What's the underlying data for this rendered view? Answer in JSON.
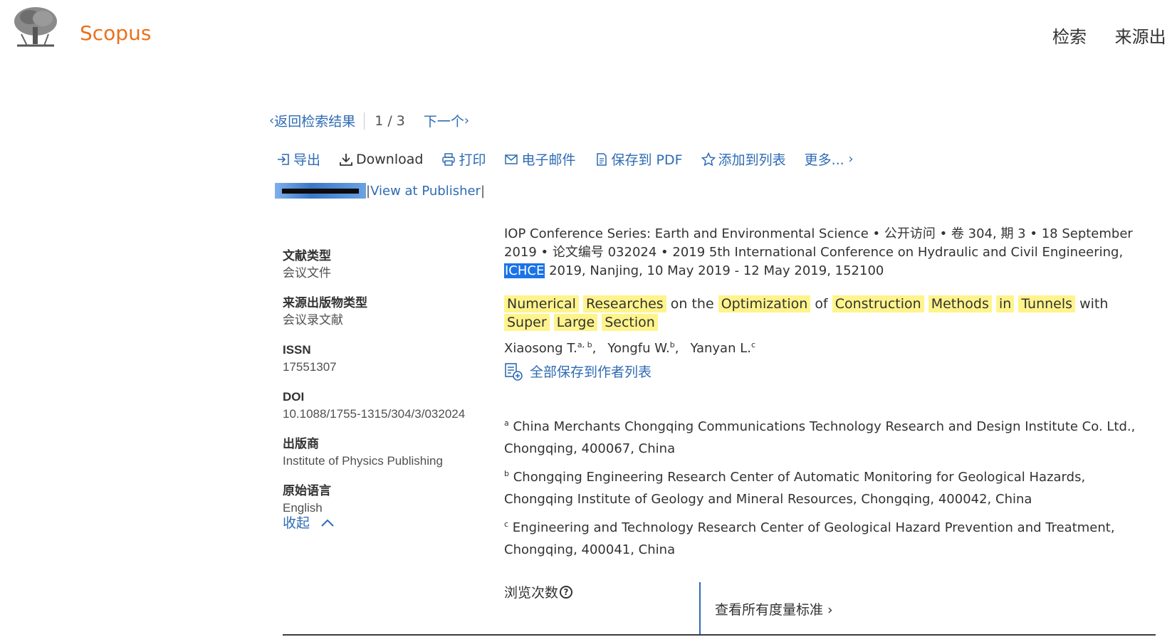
{
  "header": {
    "brand": "Scopus",
    "nav": [
      "检索",
      "来源出"
    ]
  },
  "result_nav": {
    "back_label": "返回检索结果",
    "count": "1 / 3",
    "next_label": "下一个"
  },
  "toolbar": {
    "export": "导出",
    "download": "Download",
    "print": "打印",
    "email": "电子邮件",
    "save_pdf": "保存到 PDF",
    "add_list": "添加到列表",
    "more": "更多..."
  },
  "publisher": {
    "view_label": "View at Publisher"
  },
  "meta": [
    {
      "label": "文献类型",
      "value": "会议文件"
    },
    {
      "label": "来源出版物类型",
      "value": "会议录文献"
    },
    {
      "label": "ISSN",
      "value": "17551307"
    },
    {
      "label": "DOI",
      "value": "10.1088/1755-1315/304/3/032024"
    },
    {
      "label": "出版商",
      "value": "Institute of Physics Publishing"
    },
    {
      "label": "原始语言",
      "value": "English"
    }
  ],
  "collapse_label": "收起",
  "source": {
    "pre": "IOP Conference Series: Earth and Environmental Science  •  公开访问  •  卷 304, 期 3  •  18 September 2019  •  论文编号 032024  •  2019 5th International Conference on Hydraulic and Civil Engineering, ",
    "highlight": "ICHCE",
    "post": " 2019, Nanjing, 10 May 2019 - 12 May 2019, 152100"
  },
  "title_words": [
    {
      "t": "Numerical",
      "h": true
    },
    {
      "t": "Researches",
      "h": true
    },
    {
      "t": "on",
      "h": false
    },
    {
      "t": "the",
      "h": false
    },
    {
      "t": "Optimization",
      "h": true
    },
    {
      "t": "of",
      "h": false
    },
    {
      "t": "Construction",
      "h": true
    },
    {
      "t": "Methods",
      "h": true
    },
    {
      "t": "in",
      "h": true
    },
    {
      "t": "Tunnels",
      "h": true
    },
    {
      "t": "with",
      "h": false
    },
    {
      "t": "Super",
      "h": true
    },
    {
      "t": "Large",
      "h": true
    },
    {
      "t": "Section",
      "h": true
    }
  ],
  "authors": [
    {
      "name": "Xiaosong T.",
      "sup": "a, b",
      "sep": ","
    },
    {
      "name": "Yongfu W.",
      "sup": "b",
      "sep": ","
    },
    {
      "name": "Yanyan L.",
      "sup": "c",
      "sep": ""
    }
  ],
  "save_authors_label": "全部保存到作者列表",
  "affiliations": [
    {
      "sup": "a",
      "text": "China Merchants Chongqing Communications Technology Research and Design Institute Co. Ltd., Chongqing, 400067, China"
    },
    {
      "sup": "b",
      "text": "Chongqing Engineering Research Center of Automatic Monitoring for Geological Hazards, Chongqing Institute of Geology and Mineral Resources, Chongqing, 400042, China"
    },
    {
      "sup": "c",
      "text": "Engineering and Technology Research Center of Geological Hazard Prevention and Treatment, Chongqing, 400041, China"
    }
  ],
  "views_label": "浏览次数",
  "metrics_link": "查看所有度量标准"
}
